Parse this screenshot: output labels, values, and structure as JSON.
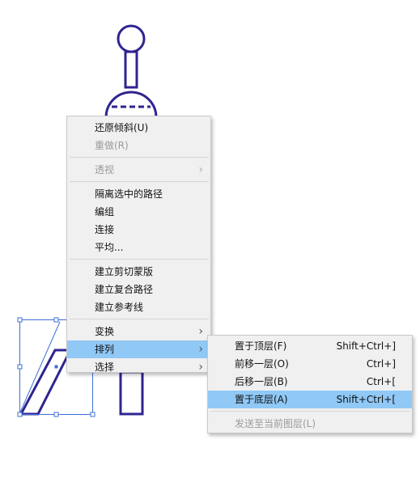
{
  "colors": {
    "artwork_stroke": "#2e2491",
    "selection_blue": "#3d6fd6",
    "menu_bg": "#f0f0f0",
    "menu_highlight": "#90c8f6",
    "disabled_text": "#9a9a9a"
  },
  "context_menu": {
    "items": [
      {
        "label": "还原倾斜(U)",
        "enabled": true
      },
      {
        "label": "重做(R)",
        "enabled": false
      },
      {
        "label": "透视",
        "enabled": false,
        "submenu": true
      },
      {
        "label": "隔离选中的路径",
        "enabled": true
      },
      {
        "label": "编组",
        "enabled": true
      },
      {
        "label": "连接",
        "enabled": true
      },
      {
        "label": "平均...",
        "enabled": true
      },
      {
        "label": "建立剪切蒙版",
        "enabled": true
      },
      {
        "label": "建立复合路径",
        "enabled": true
      },
      {
        "label": "建立参考线",
        "enabled": true
      },
      {
        "label": "变换",
        "enabled": true,
        "submenu": true
      },
      {
        "label": "排列",
        "enabled": true,
        "submenu": true,
        "highlighted": true
      },
      {
        "label": "选择",
        "enabled": true,
        "submenu": true
      }
    ]
  },
  "arrange_submenu": {
    "items": [
      {
        "label": "置于顶层(F)",
        "shortcut": "Shift+Ctrl+]",
        "enabled": true
      },
      {
        "label": "前移一层(O)",
        "shortcut": "Ctrl+]",
        "enabled": true
      },
      {
        "label": "后移一层(B)",
        "shortcut": "Ctrl+[",
        "enabled": true
      },
      {
        "label": "置于底层(A)",
        "shortcut": "Shift+Ctrl+[",
        "enabled": true,
        "highlighted": true
      },
      {
        "label": "发送至当前图层(L)",
        "enabled": false
      }
    ]
  },
  "icons": {
    "submenu_arrow": "chevron-right-icon"
  }
}
